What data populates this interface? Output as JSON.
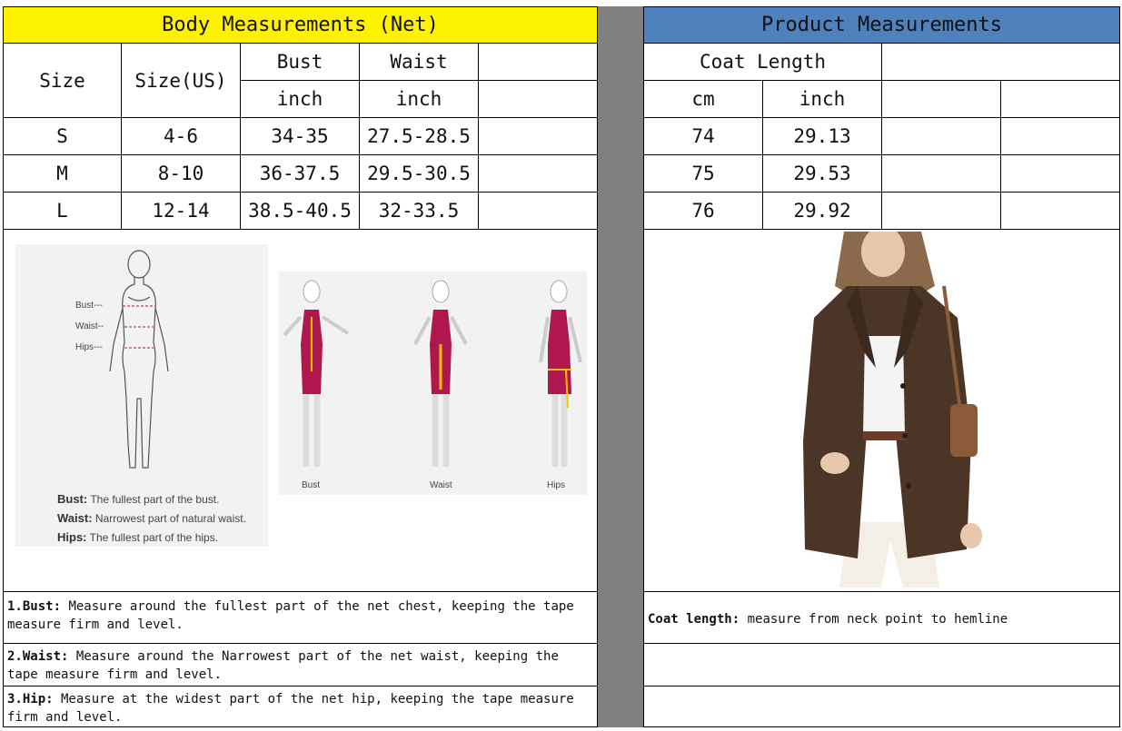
{
  "body_table": {
    "title": "Body Measurements (Net)",
    "headers": {
      "size": "Size",
      "size_us": "Size(US)",
      "bust": "Bust",
      "waist": "Waist",
      "unit_inch": "inch"
    },
    "rows": [
      {
        "size": "S",
        "size_us": "4-6",
        "bust": "34-35",
        "waist": "27.5-28.5"
      },
      {
        "size": "M",
        "size_us": "8-10",
        "bust": "36-37.5",
        "waist": "29.5-30.5"
      },
      {
        "size": "L",
        "size_us": "12-14",
        "bust": "38.5-40.5",
        "waist": "32-33.5"
      }
    ]
  },
  "product_table": {
    "title": "Product Measurements",
    "headers": {
      "coat_length": "Coat Length",
      "unit_cm": "cm",
      "unit_inch": "inch"
    },
    "rows": [
      {
        "cm": "74",
        "inch": "29.13"
      },
      {
        "cm": "75",
        "inch": "29.53"
      },
      {
        "cm": "76",
        "inch": "29.92"
      }
    ]
  },
  "figure": {
    "labels": {
      "bust": "Bust---",
      "waist": "Waist--",
      "hips": "Hips---"
    },
    "legend": [
      {
        "term": "Bust:",
        "desc": "The fullest part of the bust."
      },
      {
        "term": "Waist:",
        "desc": "Narrowest part of natural waist."
      },
      {
        "term": "Hips:",
        "desc": "The fullest part of the hips."
      }
    ],
    "captions": {
      "bust": "Bust",
      "waist": "Waist",
      "hips": "Hips"
    }
  },
  "notes": {
    "bust_term": "1.Bust:",
    "bust_text": " Measure around the fullest part of the net chest, keeping the tape  measure firm and level.",
    "waist_term": "2.Waist:",
    "waist_text": " Measure around the Narrowest part of the net waist, keeping the tape  measure firm and level.",
    "hip_term": "3.Hip:",
    "hip_text": " Measure at the widest part of the net hip, keeping the tape measure firm and level.",
    "coat_term": "Coat length:",
    "coat_text": " measure from neck point to hemline"
  },
  "colors": {
    "yellow_header": "#fff200",
    "blue_header": "#4f81bd",
    "divider": "#808080",
    "dress": "#b0174f",
    "coat": "#4a3526"
  }
}
